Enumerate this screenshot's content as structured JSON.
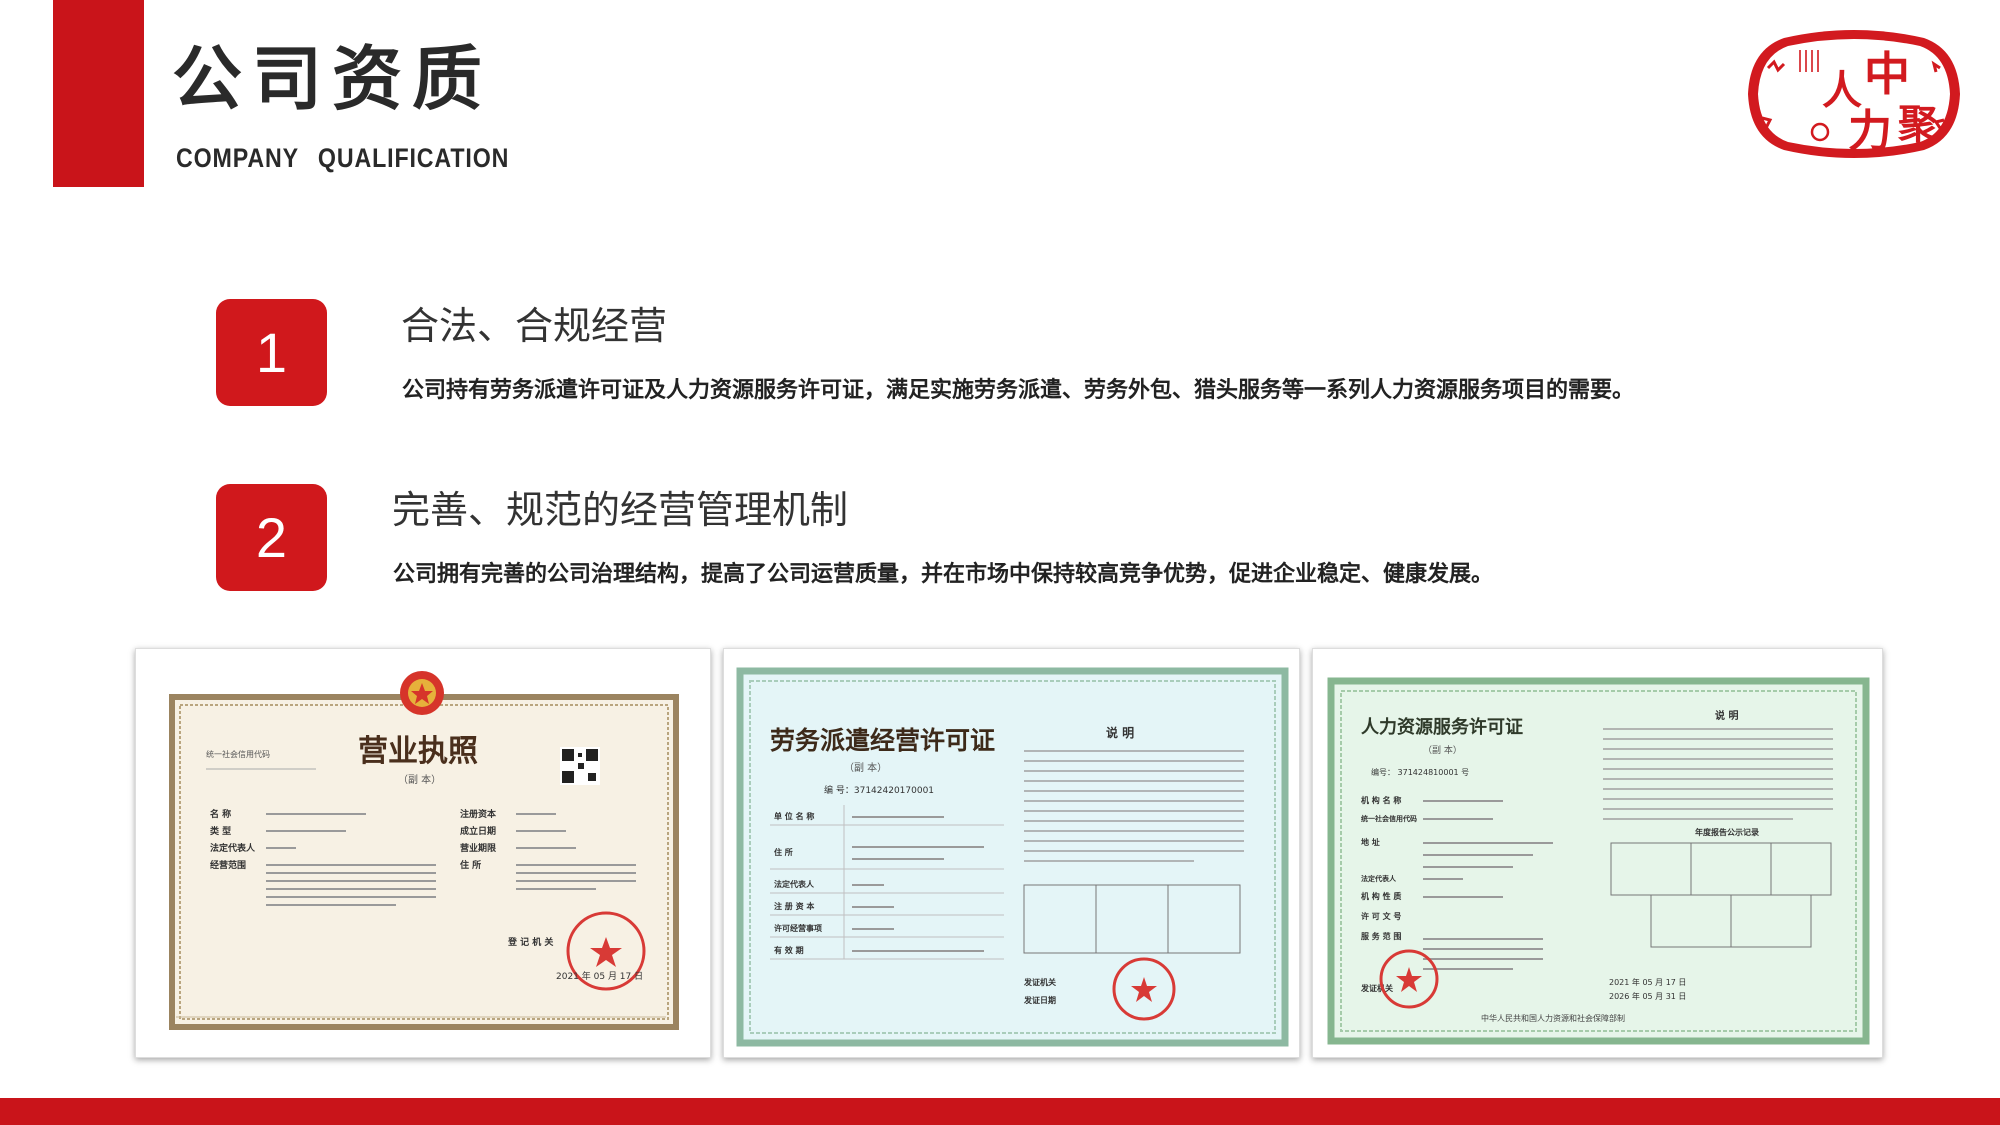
{
  "header": {
    "title": "公司资质",
    "subtitle": "COMPANY QUALIFICATION",
    "logo_text": [
      "中",
      "人",
      "聚",
      "力"
    ]
  },
  "items": [
    {
      "number": "1",
      "heading": "合法、合规经营",
      "description": "公司持有劳务派遣许可证及人力资源服务许可证，满足实施劳务派遣、劳务外包、猎头服务等一系列人力资源服务项目的需要。"
    },
    {
      "number": "2",
      "heading": "完善、规范的经营管理机制",
      "description": "公司拥有完善的公司治理结构，提高了公司运营质量，并在市场中保持较高竞争优势，促进企业稳定、健康发展。"
    }
  ],
  "certificates": [
    {
      "name": "business-license",
      "title": "营业执照",
      "copy_label": "（副 本）",
      "code_label": "统一社会信用代码",
      "fields": [
        "名 称",
        "类 型",
        "法定代表人",
        "经营范围"
      ],
      "right_fields": [
        "注册资本",
        "成立日期",
        "营业期限",
        "住 所"
      ],
      "registrar": "登 记 机 关",
      "date": "2021 年 05 月 17 日"
    },
    {
      "name": "labor-dispatch-permit",
      "title": "劳务派遣经营许可证",
      "copy_label": "（副 本）",
      "number": "编 号：37142420170001",
      "notes_title": "说 明",
      "fields": [
        "单 位 名 称",
        "住 所",
        "法定代表人",
        "注 册 资 本",
        "许可经营事项",
        "有 效 期"
      ],
      "issuer_label": "发证机关",
      "date_label": "发证日期"
    },
    {
      "name": "hr-service-permit",
      "title": "人力资源服务许可证",
      "copy_label": "（副 本）",
      "number": "编号：  371424810001  号",
      "notes_title": "说 明",
      "fields": [
        "机 构 名 称",
        "统一社会信用代码",
        "地 址",
        "法定代表人",
        "机 构 性 质",
        "许 可 文 号",
        "服 务 范 围",
        "发证机关"
      ],
      "report_title": "年度报告公示记录",
      "issue_date": "2021 年 05 月 17 日",
      "expire_date": "2026 年 05 月 31 日",
      "footer": "中华人民共和国人力资源和社会保障部制"
    }
  ],
  "colors": {
    "brand_red": "#c9141a",
    "badge_red": "#d0181c"
  }
}
